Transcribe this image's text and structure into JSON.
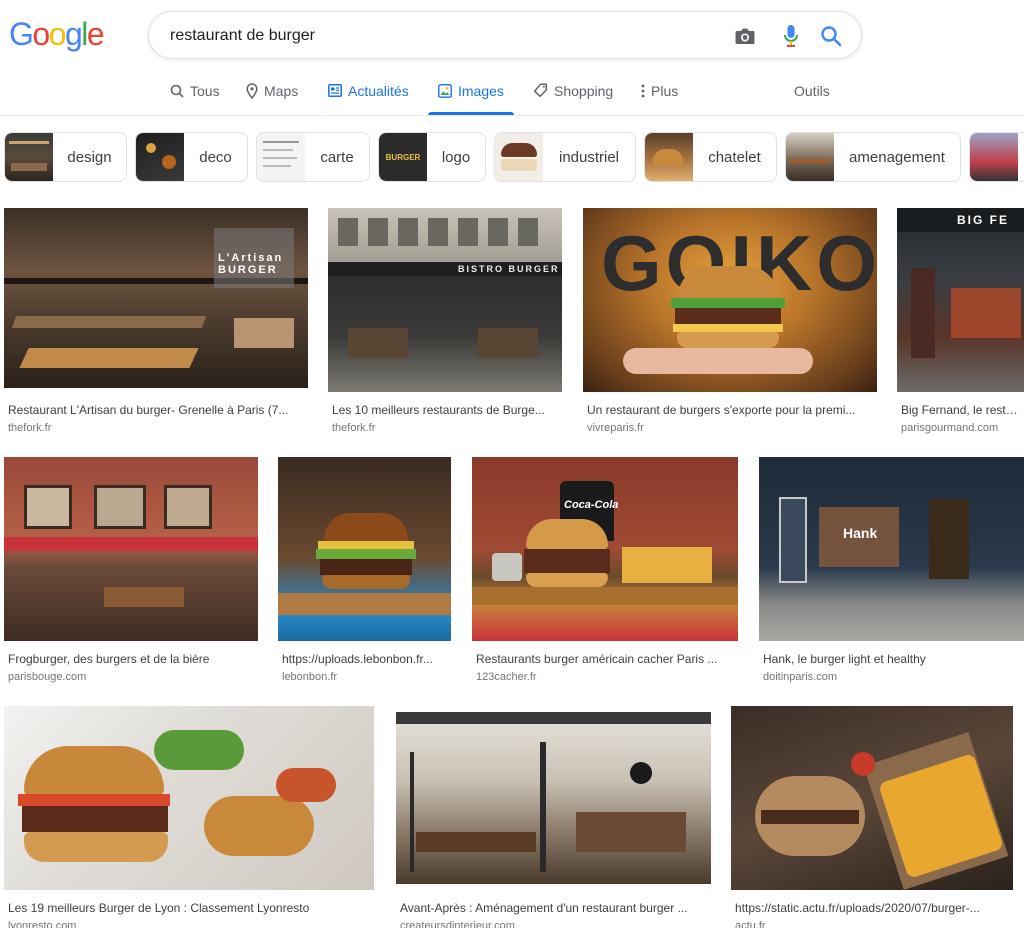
{
  "logo": {
    "letters": [
      "G",
      "o",
      "o",
      "g",
      "l",
      "e"
    ],
    "colors": [
      "#4285F4",
      "#EA4335",
      "#FBBC05",
      "#4285F4",
      "#34A853",
      "#EA4335"
    ]
  },
  "search": {
    "query": "restaurant de burger",
    "icons": [
      "camera-icon",
      "microphone-icon",
      "search-icon"
    ]
  },
  "tabs": [
    {
      "label": "Tous",
      "icon": "search-icon",
      "active": false
    },
    {
      "label": "Maps",
      "icon": "map-pin-icon",
      "active": false
    },
    {
      "label": "Actualités",
      "icon": "news-icon",
      "active": false
    },
    {
      "label": "Images",
      "icon": "image-icon",
      "active": true
    },
    {
      "label": "Shopping",
      "icon": "tag-icon",
      "active": false
    },
    {
      "label": "Plus",
      "icon": "more-vert-icon",
      "active": false
    },
    {
      "label": "Outils",
      "icon": "",
      "active": false
    }
  ],
  "chips": [
    {
      "label": "design"
    },
    {
      "label": "deco"
    },
    {
      "label": "carte"
    },
    {
      "label": "logo",
      "thumb_text": "BURGER"
    },
    {
      "label": "industriel"
    },
    {
      "label": "chatelet"
    },
    {
      "label": "amenagement"
    },
    {
      "label": ""
    }
  ],
  "results": [
    {
      "title": "Restaurant L'Artisan du burger- Grenelle à Paris (7...",
      "source": "thefork.fr",
      "overlay": "L'Artisan BURGER"
    },
    {
      "title": "Les 10 meilleurs restaurants de Burge...",
      "source": "thefork.fr",
      "overlay": "BISTRO BURGER"
    },
    {
      "title": "Un restaurant de burgers s'exporte pour la premi...",
      "source": "vivreparis.fr",
      "overlay": "GOIKO"
    },
    {
      "title": "Big Fernand, le restau...",
      "source": "parisgourmand.com",
      "overlay": "BIG FE"
    },
    {
      "title": "Frogburger, des burgers et de la bière",
      "source": "parisbouge.com"
    },
    {
      "title": "https://uploads.lebonbon.fr...",
      "source": "lebonbon.fr"
    },
    {
      "title": "Restaurants burger américain cacher Paris ...",
      "source": "123cacher.fr",
      "overlay": "Coca-Cola"
    },
    {
      "title": "Hank, le burger light et healthy",
      "source": "doitinparis.com",
      "overlay": "Hank"
    },
    {
      "title": "Les 19 meilleurs Burger de Lyon : Classement Lyonresto",
      "source": "lyonresto.com"
    },
    {
      "title": "Avant-Après : Aménagement d'un restaurant burger ...",
      "source": "createursdinterieur.com"
    },
    {
      "title": "https://static.actu.fr/uploads/2020/07/burger-...",
      "source": "actu.fr"
    }
  ]
}
